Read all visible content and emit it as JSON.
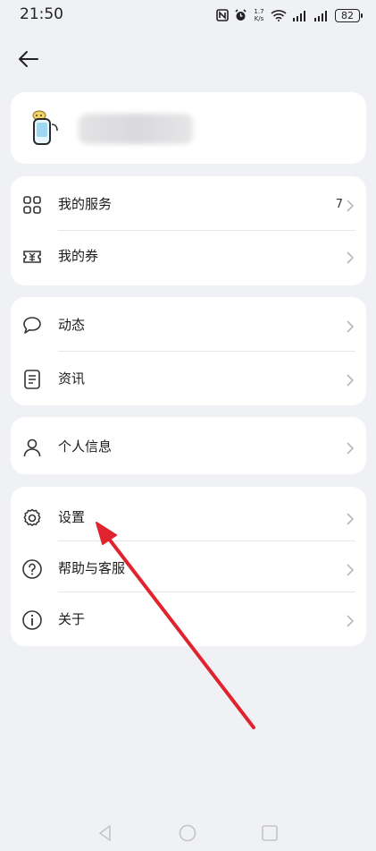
{
  "status_bar": {
    "time": "21:50",
    "speed_top": "1.7",
    "speed_bottom": "K/s",
    "battery": "82"
  },
  "menu": {
    "group1": [
      {
        "label": "我的服务",
        "count": "7",
        "icon": "grid-icon"
      },
      {
        "label": "我的券",
        "count": "",
        "icon": "coupon-icon"
      }
    ],
    "group2": [
      {
        "label": "动态",
        "icon": "chat-bubble-icon"
      },
      {
        "label": "资讯",
        "icon": "document-icon"
      }
    ],
    "group3": [
      {
        "label": "个人信息",
        "icon": "person-icon"
      }
    ],
    "group4": [
      {
        "label": "设置",
        "icon": "gear-icon"
      },
      {
        "label": "帮助与客服",
        "icon": "help-icon"
      },
      {
        "label": "关于",
        "icon": "info-icon"
      }
    ]
  },
  "colors": {
    "background": "#f0f1f5",
    "card": "#ffffff",
    "annotation_arrow": "#e0232e"
  }
}
